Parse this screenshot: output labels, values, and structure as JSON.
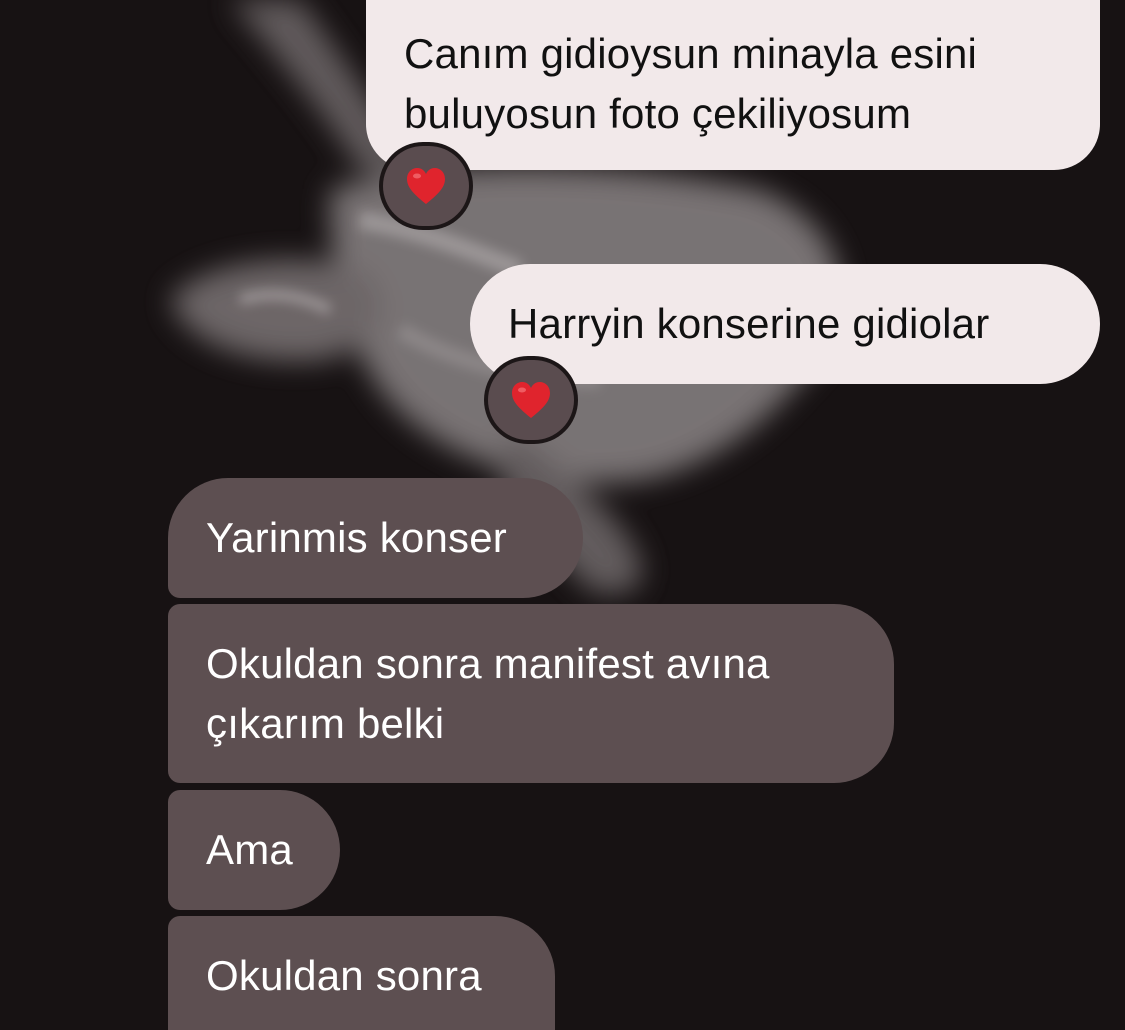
{
  "conversation": {
    "messages": [
      {
        "direction": "outgoing",
        "lines": [
          "Canım gidioysun minayla esini",
          "buluyosun foto çekiliyosum"
        ],
        "reaction": "heart-reaction-icon"
      },
      {
        "direction": "outgoing",
        "lines": [
          "Harryin konserine gidiolar"
        ],
        "reaction": "heart-reaction-icon"
      },
      {
        "direction": "incoming",
        "lines": [
          "Yarinmis konser"
        ]
      },
      {
        "direction": "incoming",
        "lines": [
          "Okuldan sonra manifest avına",
          "çıkarım belki"
        ]
      },
      {
        "direction": "incoming",
        "lines": [
          "Ama"
        ]
      },
      {
        "direction": "incoming",
        "lines": [
          "Okuldan sonra"
        ]
      }
    ]
  },
  "colors": {
    "background": "#171213",
    "sent_bubble": "#f2e9ea",
    "received_bubble": "#5d4f51",
    "reaction_pill": "#5a4c4f",
    "heart": "#e0242d"
  },
  "wallpaper": {
    "subject": "cat-photo-wallpaper"
  }
}
